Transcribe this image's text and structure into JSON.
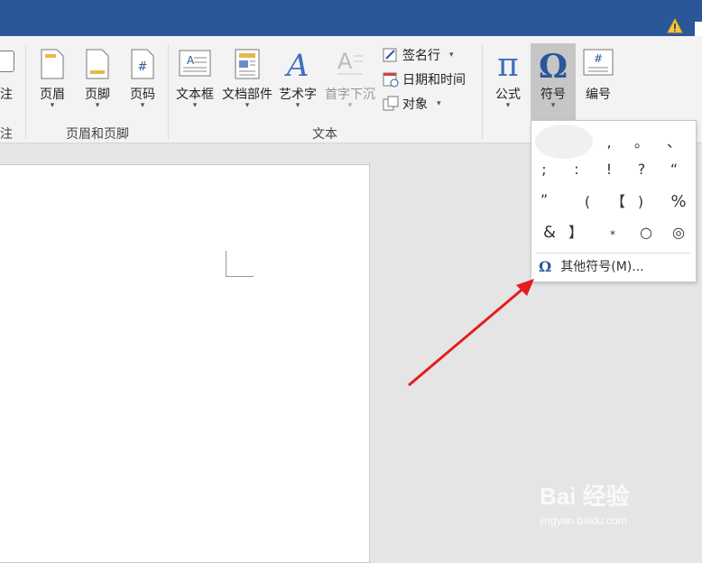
{
  "ribbon": {
    "partial_left_label": "注",
    "partial_left_group": "注",
    "header_footer": {
      "items": [
        {
          "label": "页眉",
          "icon": "header-icon"
        },
        {
          "label": "页脚",
          "icon": "footer-icon"
        },
        {
          "label": "页码",
          "icon": "page-number-icon"
        }
      ],
      "group_label": "页眉和页脚"
    },
    "text": {
      "items": [
        {
          "label": "文本框",
          "icon": "textbox-icon"
        },
        {
          "label": "文档部件",
          "icon": "quick-parts-icon"
        },
        {
          "label": "艺术字",
          "icon": "wordart-icon"
        },
        {
          "label": "首字下沉",
          "icon": "drop-cap-icon",
          "disabled": true
        }
      ],
      "small_items": [
        {
          "label": "签名行",
          "icon": "signature-line-icon",
          "has_dropdown": true
        },
        {
          "label": "日期和时间",
          "icon": "date-time-icon",
          "has_dropdown": false
        },
        {
          "label": "对象",
          "icon": "object-icon",
          "has_dropdown": true
        }
      ],
      "group_label": "文本"
    },
    "symbols": {
      "items": [
        {
          "label": "公式",
          "icon": "equation-pi-icon"
        },
        {
          "label": "符号",
          "icon": "symbol-omega-icon",
          "active": true
        },
        {
          "label": "编号",
          "icon": "number-icon"
        }
      ]
    }
  },
  "symbol_menu": {
    "symbols": [
      [
        "",
        ",",
        "。",
        "、"
      ],
      [
        ";",
        ":",
        "!",
        "?",
        "“"
      ],
      [
        "”",
        "(",
        "【",
        ")",
        "%"
      ],
      [
        "&",
        "】",
        "*",
        "○",
        "◎"
      ]
    ],
    "more_label": "其他符号(M)...",
    "more_icon": "omega-icon"
  },
  "colors": {
    "titlebar": "#2b579a",
    "arrow": "#e51c1c",
    "accent": "#2b579a"
  },
  "watermark": {
    "brand": "Bai 经验",
    "url": "jingyan.baidu.com"
  }
}
